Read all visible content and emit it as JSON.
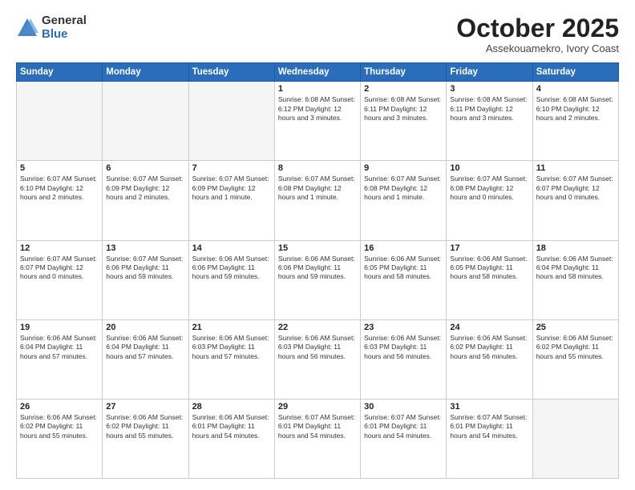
{
  "logo": {
    "general": "General",
    "blue": "Blue"
  },
  "title": "October 2025",
  "location": "Assekouamekro, Ivory Coast",
  "weekdays": [
    "Sunday",
    "Monday",
    "Tuesday",
    "Wednesday",
    "Thursday",
    "Friday",
    "Saturday"
  ],
  "weeks": [
    [
      {
        "day": "",
        "info": ""
      },
      {
        "day": "",
        "info": ""
      },
      {
        "day": "",
        "info": ""
      },
      {
        "day": "1",
        "info": "Sunrise: 6:08 AM\nSunset: 6:12 PM\nDaylight: 12 hours\nand 3 minutes."
      },
      {
        "day": "2",
        "info": "Sunrise: 6:08 AM\nSunset: 6:11 PM\nDaylight: 12 hours\nand 3 minutes."
      },
      {
        "day": "3",
        "info": "Sunrise: 6:08 AM\nSunset: 6:11 PM\nDaylight: 12 hours\nand 3 minutes."
      },
      {
        "day": "4",
        "info": "Sunrise: 6:08 AM\nSunset: 6:10 PM\nDaylight: 12 hours\nand 2 minutes."
      }
    ],
    [
      {
        "day": "5",
        "info": "Sunrise: 6:07 AM\nSunset: 6:10 PM\nDaylight: 12 hours\nand 2 minutes."
      },
      {
        "day": "6",
        "info": "Sunrise: 6:07 AM\nSunset: 6:09 PM\nDaylight: 12 hours\nand 2 minutes."
      },
      {
        "day": "7",
        "info": "Sunrise: 6:07 AM\nSunset: 6:09 PM\nDaylight: 12 hours\nand 1 minute."
      },
      {
        "day": "8",
        "info": "Sunrise: 6:07 AM\nSunset: 6:08 PM\nDaylight: 12 hours\nand 1 minute."
      },
      {
        "day": "9",
        "info": "Sunrise: 6:07 AM\nSunset: 6:08 PM\nDaylight: 12 hours\nand 1 minute."
      },
      {
        "day": "10",
        "info": "Sunrise: 6:07 AM\nSunset: 6:08 PM\nDaylight: 12 hours\nand 0 minutes."
      },
      {
        "day": "11",
        "info": "Sunrise: 6:07 AM\nSunset: 6:07 PM\nDaylight: 12 hours\nand 0 minutes."
      }
    ],
    [
      {
        "day": "12",
        "info": "Sunrise: 6:07 AM\nSunset: 6:07 PM\nDaylight: 12 hours\nand 0 minutes."
      },
      {
        "day": "13",
        "info": "Sunrise: 6:07 AM\nSunset: 6:06 PM\nDaylight: 11 hours\nand 59 minutes."
      },
      {
        "day": "14",
        "info": "Sunrise: 6:06 AM\nSunset: 6:06 PM\nDaylight: 11 hours\nand 59 minutes."
      },
      {
        "day": "15",
        "info": "Sunrise: 6:06 AM\nSunset: 6:06 PM\nDaylight: 11 hours\nand 59 minutes."
      },
      {
        "day": "16",
        "info": "Sunrise: 6:06 AM\nSunset: 6:05 PM\nDaylight: 11 hours\nand 58 minutes."
      },
      {
        "day": "17",
        "info": "Sunrise: 6:06 AM\nSunset: 6:05 PM\nDaylight: 11 hours\nand 58 minutes."
      },
      {
        "day": "18",
        "info": "Sunrise: 6:06 AM\nSunset: 6:04 PM\nDaylight: 11 hours\nand 58 minutes."
      }
    ],
    [
      {
        "day": "19",
        "info": "Sunrise: 6:06 AM\nSunset: 6:04 PM\nDaylight: 11 hours\nand 57 minutes."
      },
      {
        "day": "20",
        "info": "Sunrise: 6:06 AM\nSunset: 6:04 PM\nDaylight: 11 hours\nand 57 minutes."
      },
      {
        "day": "21",
        "info": "Sunrise: 6:06 AM\nSunset: 6:03 PM\nDaylight: 11 hours\nand 57 minutes."
      },
      {
        "day": "22",
        "info": "Sunrise: 6:06 AM\nSunset: 6:03 PM\nDaylight: 11 hours\nand 56 minutes."
      },
      {
        "day": "23",
        "info": "Sunrise: 6:06 AM\nSunset: 6:03 PM\nDaylight: 11 hours\nand 56 minutes."
      },
      {
        "day": "24",
        "info": "Sunrise: 6:06 AM\nSunset: 6:02 PM\nDaylight: 11 hours\nand 56 minutes."
      },
      {
        "day": "25",
        "info": "Sunrise: 6:06 AM\nSunset: 6:02 PM\nDaylight: 11 hours\nand 55 minutes."
      }
    ],
    [
      {
        "day": "26",
        "info": "Sunrise: 6:06 AM\nSunset: 6:02 PM\nDaylight: 11 hours\nand 55 minutes."
      },
      {
        "day": "27",
        "info": "Sunrise: 6:06 AM\nSunset: 6:02 PM\nDaylight: 11 hours\nand 55 minutes."
      },
      {
        "day": "28",
        "info": "Sunrise: 6:06 AM\nSunset: 6:01 PM\nDaylight: 11 hours\nand 54 minutes."
      },
      {
        "day": "29",
        "info": "Sunrise: 6:07 AM\nSunset: 6:01 PM\nDaylight: 11 hours\nand 54 minutes."
      },
      {
        "day": "30",
        "info": "Sunrise: 6:07 AM\nSunset: 6:01 PM\nDaylight: 11 hours\nand 54 minutes."
      },
      {
        "day": "31",
        "info": "Sunrise: 6:07 AM\nSunset: 6:01 PM\nDaylight: 11 hours\nand 54 minutes."
      },
      {
        "day": "",
        "info": ""
      }
    ]
  ]
}
